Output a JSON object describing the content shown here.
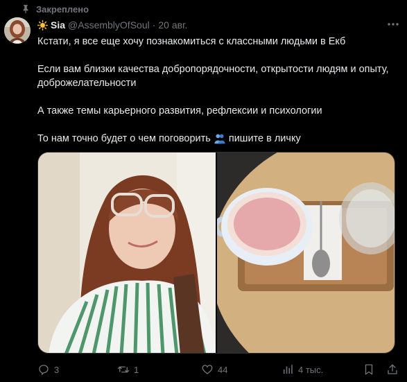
{
  "pinned": {
    "label": "Закреплено",
    "icon": "pin-icon"
  },
  "author": {
    "name": "Sia",
    "handle": "@AssemblyOfSoul",
    "separator": "·",
    "date": "20 авг.",
    "name_prefix_icon": "sun-icon",
    "avatar": "avatar-photo"
  },
  "post": {
    "paragraphs": [
      "Кстати, я все еще хочу познакомиться с классными людьми в Екб",
      "Если вам близки качества добропорядочности, открытости людям и опыту, доброжелательности",
      "А также темы карьерного развития, рефлексии и психологии"
    ],
    "last_line_before": "То нам точно будет о чем поговорить",
    "last_line_emoji": "people-hugging-emoji",
    "last_line_after": "пишите в личку"
  },
  "media": [
    {
      "name": "selfie-photo"
    },
    {
      "name": "coffee-photo"
    }
  ],
  "actions": {
    "replies": "3",
    "retweets": "1",
    "likes": "44",
    "views": "4 тыс."
  },
  "colors": {
    "background": "#000000",
    "text": "#e7e9ea",
    "muted": "#71767b",
    "border": "#2f3336"
  }
}
